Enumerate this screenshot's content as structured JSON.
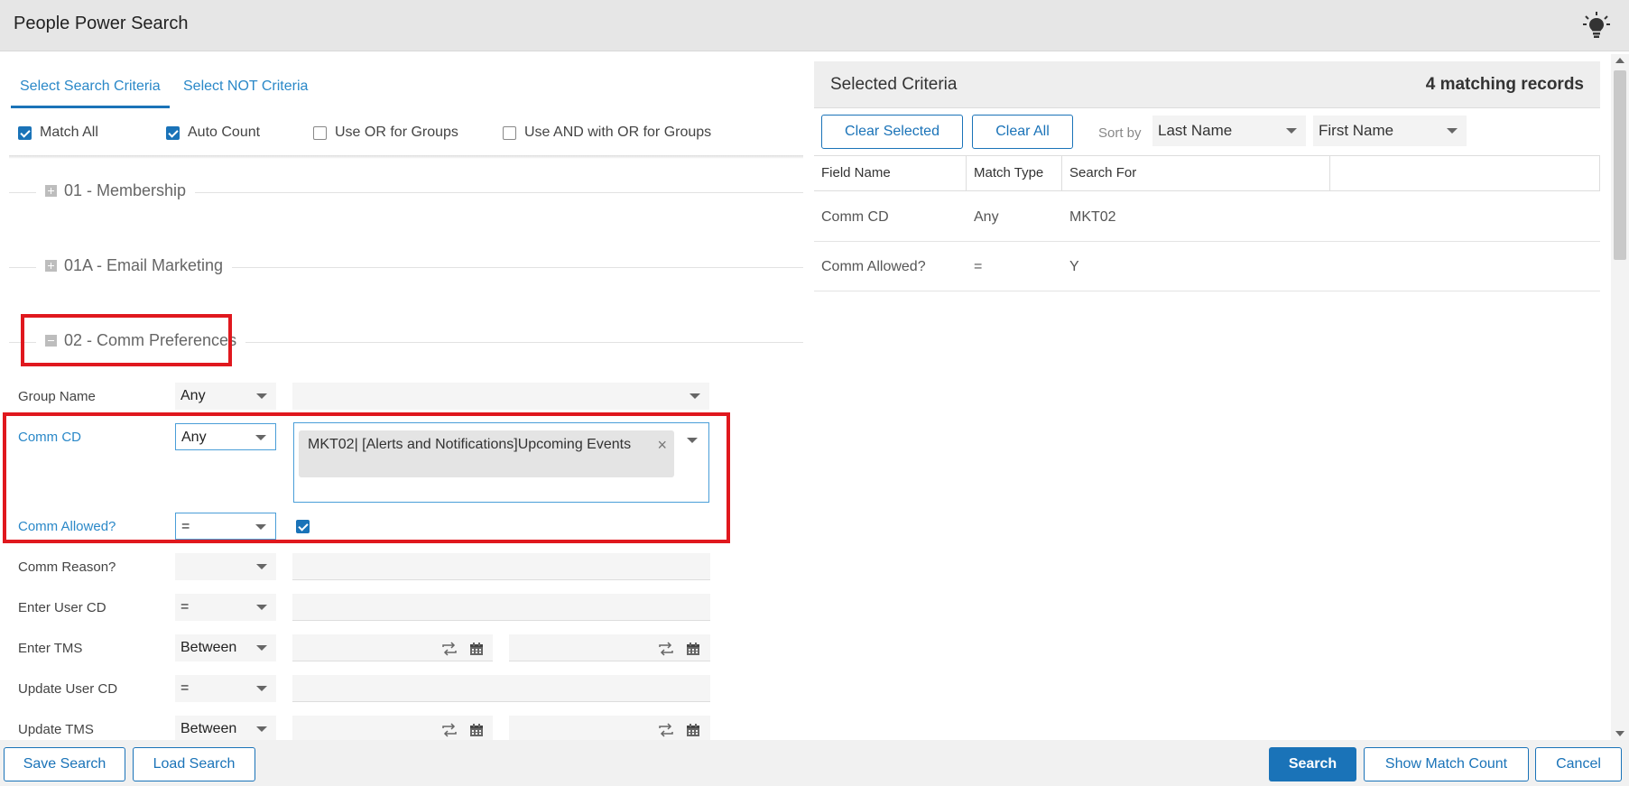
{
  "window": {
    "title": "People Power Search",
    "help_icon": "lightbulb-icon"
  },
  "tabs": [
    {
      "label": "Select Search Criteria",
      "active": true
    },
    {
      "label": "Select NOT Criteria",
      "active": false
    }
  ],
  "options": [
    {
      "label": "Match All",
      "checked": true
    },
    {
      "label": "Auto Count",
      "checked": true
    },
    {
      "label": "Use OR for Groups",
      "checked": false
    },
    {
      "label": "Use AND with OR for Groups",
      "checked": false
    }
  ],
  "sections": [
    {
      "label": "01 - Membership",
      "expanded": false
    },
    {
      "label": "01A - Email Marketing",
      "expanded": false
    },
    {
      "label": "02 - Comm Preferences",
      "expanded": true
    }
  ],
  "fields": {
    "group_name": {
      "label": "Group Name",
      "match": "Any",
      "value": ""
    },
    "comm_cd": {
      "label": "Comm CD",
      "match": "Any",
      "chip": "MKT02| [Alerts and Notifications]Upcoming Events",
      "chip_remove": "×"
    },
    "comm_allowed": {
      "label": "Comm Allowed?",
      "match": "=",
      "checked": true
    },
    "comm_reason": {
      "label": "Comm Reason?",
      "match": "",
      "value": ""
    },
    "enter_user_cd": {
      "label": "Enter User CD",
      "match": "=",
      "value": ""
    },
    "enter_tms": {
      "label": "Enter TMS",
      "match": "Between",
      "value_from": "",
      "value_to": ""
    },
    "update_user_cd": {
      "label": "Update User CD",
      "match": "=",
      "value": ""
    },
    "update_tms": {
      "label": "Update TMS",
      "match": "Between",
      "value_from": "",
      "value_to": ""
    }
  },
  "right_panel": {
    "title": "Selected Criteria",
    "match_count": "4 matching records",
    "clear_selected": "Clear Selected",
    "clear_all": "Clear All",
    "sort_by_label": "Sort by",
    "sort_primary": "Last Name",
    "sort_secondary": "First Name",
    "columns": [
      "Field Name",
      "Match Type",
      "Search For",
      ""
    ],
    "rows": [
      {
        "field": "Comm CD",
        "match": "Any",
        "value": "MKT02"
      },
      {
        "field": "Comm Allowed?",
        "match": "=",
        "value": "Y"
      }
    ]
  },
  "footer": {
    "save_search": "Save Search",
    "load_search": "Load Search",
    "search": "Search",
    "show_match_count": "Show Match Count",
    "cancel": "Cancel"
  },
  "colors": {
    "accent": "#1a73b8",
    "link": "#2a88c8",
    "highlight": "#e0181e",
    "titlebar": "#e6e6e6"
  }
}
